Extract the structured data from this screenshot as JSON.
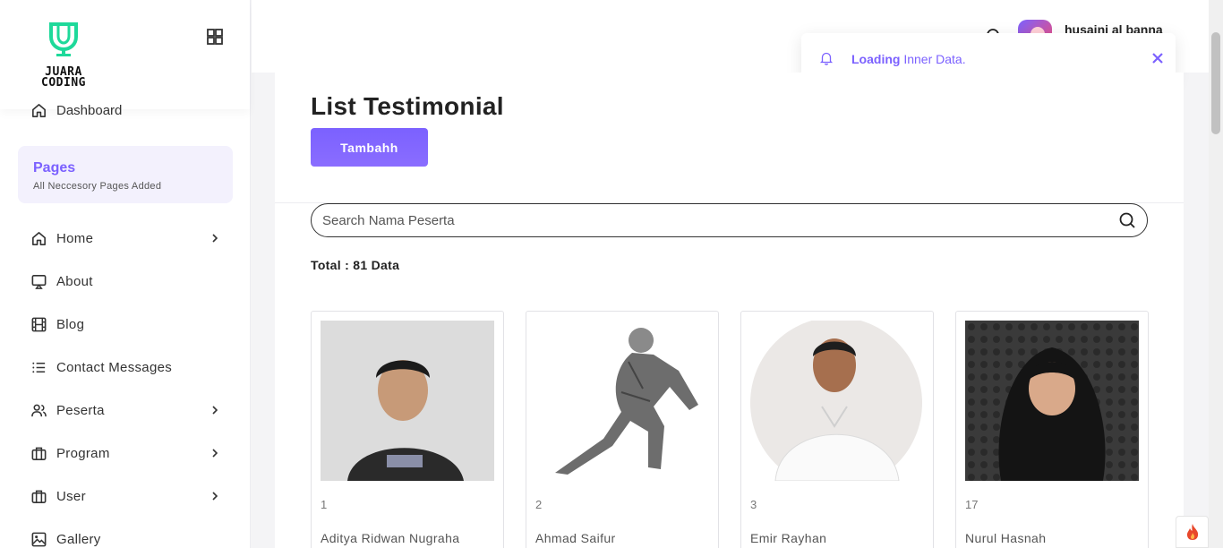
{
  "logo": {
    "line1": "JUARA",
    "line2": "CODING"
  },
  "sidebar": {
    "dashboard": "Dashboard",
    "pages_title": "Pages",
    "pages_sub": "All Neccesory Pages Added",
    "items": [
      {
        "label": "Home",
        "icon": "home-icon",
        "chevron": true
      },
      {
        "label": "About",
        "icon": "monitor-icon",
        "chevron": false
      },
      {
        "label": "Blog",
        "icon": "film-icon",
        "chevron": false
      },
      {
        "label": "Contact Messages",
        "icon": "list-icon",
        "chevron": false
      },
      {
        "label": "Peserta",
        "icon": "users-icon",
        "chevron": true
      },
      {
        "label": "Program",
        "icon": "briefcase-icon",
        "chevron": true
      },
      {
        "label": "User",
        "icon": "briefcase-icon",
        "chevron": true
      },
      {
        "label": "Gallery",
        "icon": "image-icon",
        "chevron": false
      }
    ]
  },
  "header": {
    "username": "husaini al banna"
  },
  "toast": {
    "bold": "Loading",
    "text": " Inner Data.",
    "progress_pct": 71
  },
  "main": {
    "title": "List Testimonial",
    "add_button": "Tambahh",
    "search_placeholder": "Search Nama Peserta",
    "total": "Total : 81 Data",
    "cards": [
      {
        "num": "1",
        "name": "Aditya Ridwan Nugraha"
      },
      {
        "num": "2",
        "name": "Ahmad Saifur"
      },
      {
        "num": "3",
        "name": "Emir Rayhan"
      },
      {
        "num": "17",
        "name": "Nurul Hasnah"
      }
    ]
  },
  "colors": {
    "accent": "#7b61ff",
    "logo_green": "#1ed99a"
  }
}
